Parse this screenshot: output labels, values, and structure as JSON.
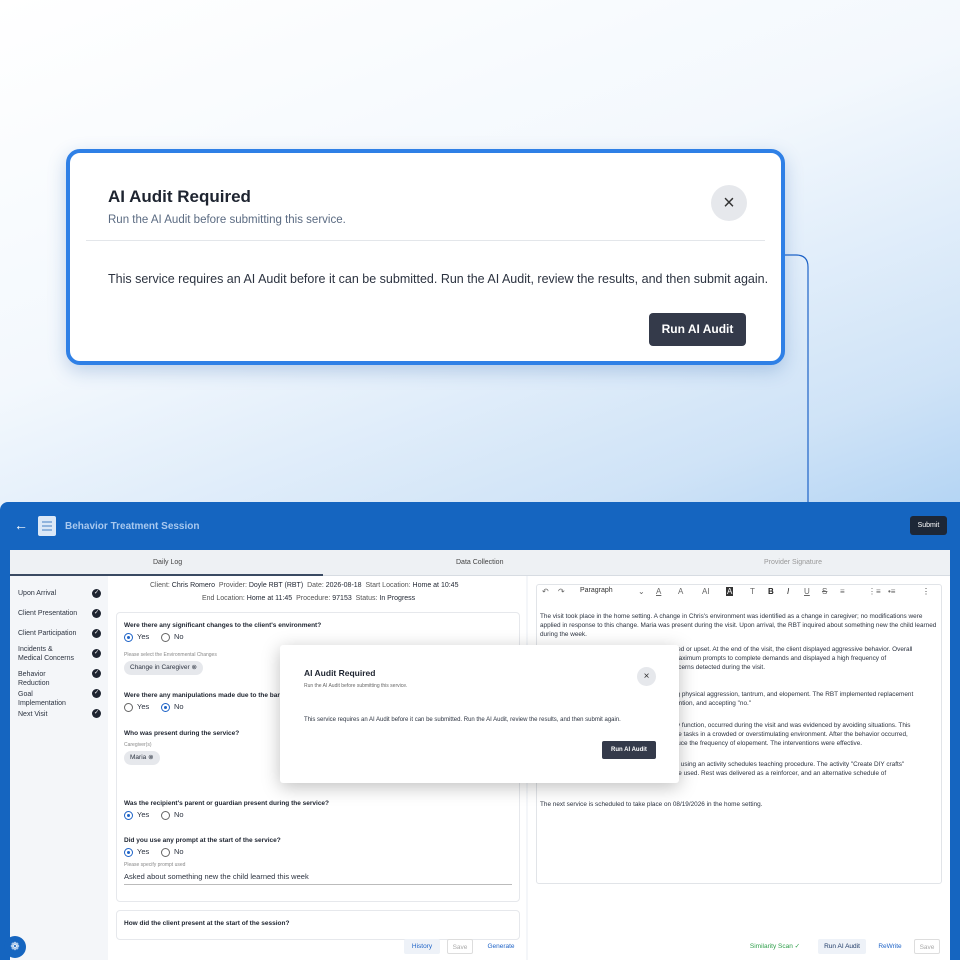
{
  "callout": {
    "title": "AI Audit Required",
    "subtitle": "Run the AI Audit before submitting this service.",
    "close_icon": "×",
    "message": "This service requires an AI Audit before it can be submitted. Run the AI Audit, review the results, and then submit again.",
    "button": "Run AI Audit"
  },
  "app": {
    "back_icon": "←",
    "title": "Behavior Treatment Session",
    "submit": "Submit",
    "tabs": [
      "Daily Log",
      "Data Collection",
      "Provider Signature"
    ],
    "sidebar": [
      "Upon Arrival",
      "Client Presentation",
      "Client Participation",
      "Incidents & Medical Concerns",
      "Behavior Reduction",
      "Goal Implementation",
      "Next Visit"
    ],
    "check_icon": "✓",
    "meta": {
      "client_label": "Client:",
      "client": "Chris Romero",
      "provider_label": "Provider:",
      "provider": "Doyle RBT (RBT)",
      "date_label": "Date:",
      "date": "2026-08-18",
      "start_label": "Start Location:",
      "start": "Home at 10:45",
      "end_label": "End Location:",
      "end": "Home at 11:45",
      "procedure_label": "Procedure:",
      "procedure": "97153",
      "status_label": "Status:",
      "status": "In Progress"
    },
    "questions": {
      "q1": "Were there any significant changes to the client's environment?",
      "q1_yes": "Yes",
      "q1_no": "No",
      "q1_hint": "Please select the Environmental Changes",
      "q1_chip": "Change in Caregiver",
      "q2": "Were there any manipulations made due to the barri",
      "q2_yes": "Yes",
      "q2_no": "No",
      "q3": "Who was present during the service?",
      "q3_hint": "Caregiver(s)",
      "q3_chip": "Maria",
      "q4": "Was the recipient's parent or guardian present during the service?",
      "q4_yes": "Yes",
      "q4_no": "No",
      "q5": "Did you use any prompt at the start of the service?",
      "q5_yes": "Yes",
      "q5_no": "No",
      "q5_hint": "Please specify prompt used",
      "q5_value": "Asked about something new the child learned this week",
      "q6": "How did the client present at the start of the session?"
    },
    "chip_remove_icon": "⊗",
    "main_footer": {
      "history": "History",
      "save": "Save",
      "generate": "Generate"
    },
    "editor": {
      "undo_icon": "↶",
      "redo_icon": "↷",
      "block_style": "Paragraph",
      "font_color_icon": "A",
      "font_size_icon": "A",
      "ai_tools": "AI",
      "highlight_icon": "A",
      "clear_format_icon": "T",
      "bold": "B",
      "italic": "I",
      "underline": "U",
      "strike": "S",
      "align_icon": "≡",
      "ordered_list_icon": "⋮≡",
      "bullet_list_icon": "•≡",
      "more_icon": "⋮",
      "p1": "The visit took place in the home setting. A change in Chris's environment was identified as a change in caregiver; no modifications were applied in response to this change. Maria was present during the visit. Upon arrival, the RBT inquired about something new the child learned during the week.",
      "p2a": "trated or upset. At the end of the visit, the client displayed aggressive behavior. Overall",
      "p2b": "d maximum prompts to complete demands and displayed a high frequency of",
      "p2c": "concerns detected during the visit.",
      "p3a": "ding physical aggression, tantrum, and elopement. The RBT implemented replacement",
      "p3b": "attention, and accepting \"no.\"",
      "p4a": "sory function, occurred during the visit and was evidenced by avoiding situations. This",
      "p4b": "plete tasks in a crowded or overstimulating environment. After the behavior occurred,",
      "p4c": "reduce the frequency of elopement. The interventions were effective.",
      "p5a": "visit using an activity schedules teaching procedure. The activity \"Create DIY crafts\"",
      "p5b": "were used. Rest was delivered as a reinforcer, and an alternative schedule of",
      "p6": "The next service is scheduled to take place on 08/19/2026 in the home setting."
    },
    "right_footer": {
      "similarity": "Similarity Scan",
      "similarity_icon": "✓",
      "run_audit": "Run AI Audit",
      "rewrite": "ReWrite",
      "save": "Save"
    }
  },
  "modal": {
    "title": "AI Audit Required",
    "subtitle": "Run the AI Audit before submitting this service.",
    "close_icon": "×",
    "message": "This service requires an AI Audit before it can be submitted. Run the AI Audit, review the results, and then submit again.",
    "button": "Run AI Audit"
  },
  "cookie_icon": "❁",
  "colors": {
    "accent": "#1565c0",
    "callout_border": "#2f80e6",
    "button_dark": "#343a4a",
    "green": "#2e9e4a"
  }
}
